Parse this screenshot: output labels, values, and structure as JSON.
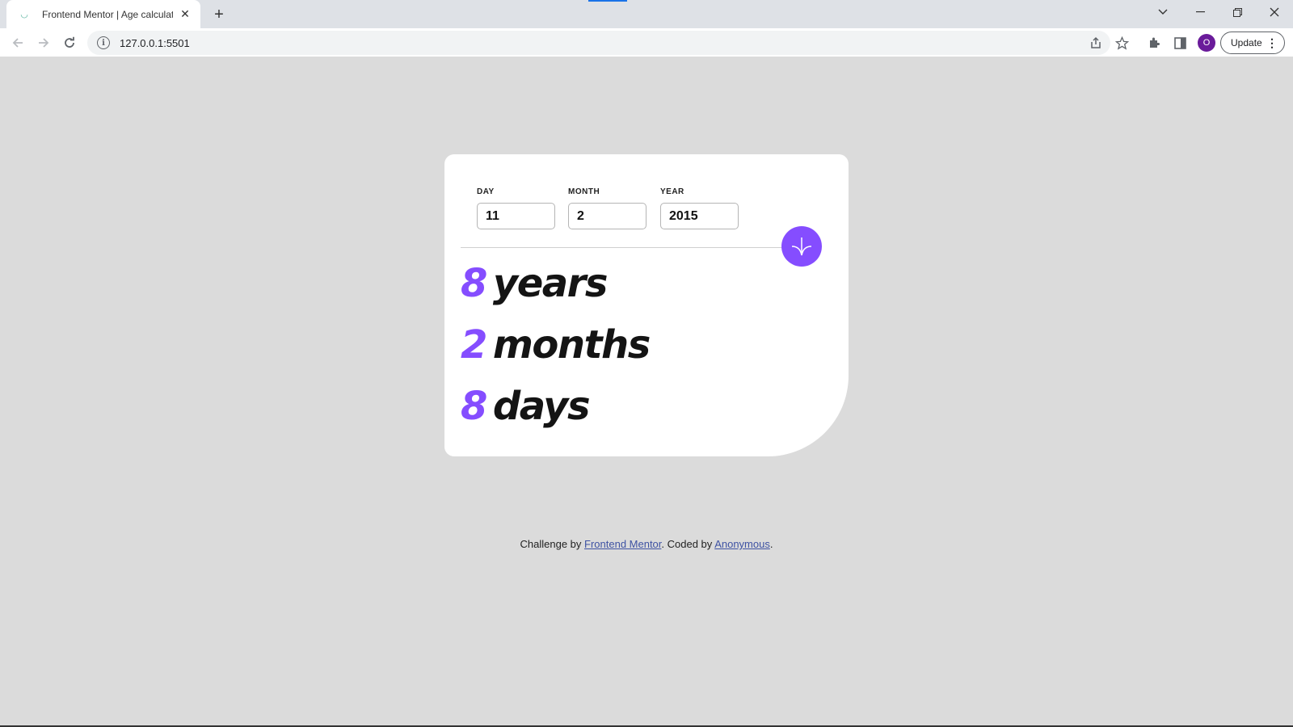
{
  "browser": {
    "tab_title": "Frontend Mentor | Age calculator",
    "url": "127.0.0.1:5501",
    "profile_initial": "O",
    "update_label": "Update"
  },
  "form": {
    "day_label": "DAY",
    "day_value": "11",
    "month_label": "MONTH",
    "month_value": "2",
    "year_label": "YEAR",
    "year_value": "2015"
  },
  "results": {
    "years_value": "8",
    "years_unit": "years",
    "months_value": "2",
    "months_unit": "months",
    "days_value": "8",
    "days_unit": "days"
  },
  "footer": {
    "prefix": "Challenge by ",
    "link1": "Frontend Mentor",
    "middle": ". Coded by ",
    "link2": "Anonymous",
    "suffix": "."
  },
  "colors": {
    "accent": "#854dff",
    "background": "#dbdbdb",
    "card": "#ffffff"
  }
}
